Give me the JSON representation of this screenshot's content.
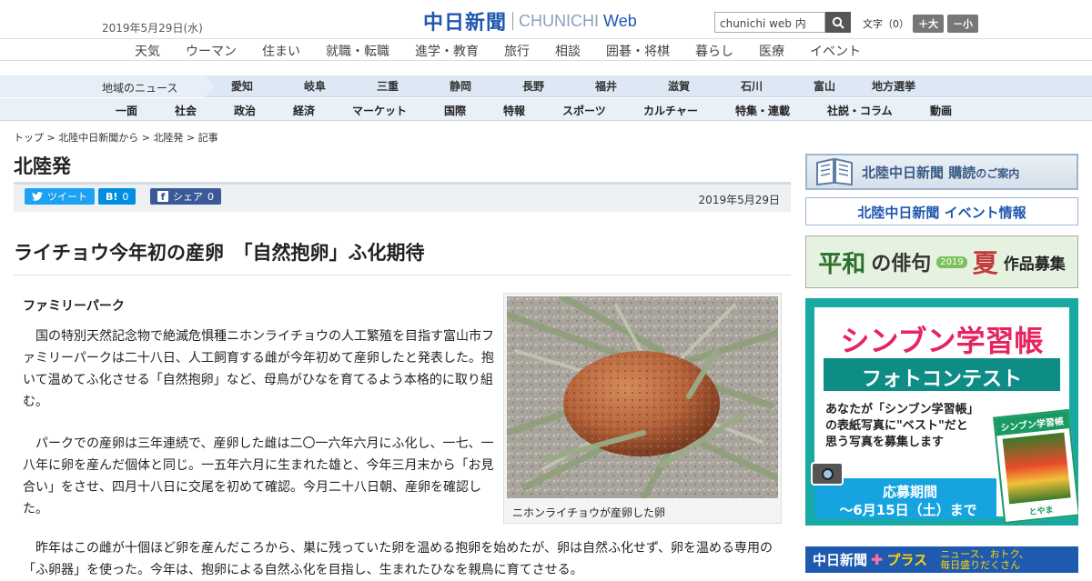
{
  "header": {
    "date": "2019年5月29日(水)",
    "logo_jp": "中日新聞",
    "logo_en": "CHUNICHI",
    "logo_web": "Web",
    "search_placeholder": "chunichi web 内",
    "font_label": "文字（0）",
    "font_larger": "＋大",
    "font_smaller": "－小"
  },
  "nav_categories": [
    "天気",
    "ウーマン",
    "住まい",
    "就職・転職",
    "進学・教育",
    "旅行",
    "相談",
    "囲碁・将棋",
    "暮らし",
    "医療",
    "イベント"
  ],
  "nav_region": {
    "label": "地域のニュース",
    "items": [
      "愛知",
      "岐阜",
      "三重",
      "静岡",
      "長野",
      "福井",
      "滋賀",
      "石川",
      "富山",
      "地方選挙"
    ]
  },
  "nav_sections": [
    "一面",
    "社会",
    "政治",
    "経済",
    "マーケット",
    "国際",
    "特報",
    "スポーツ",
    "カルチャー",
    "特集・連載",
    "社説・コラム",
    "動画"
  ],
  "breadcrumb": [
    "トップ",
    "北陸中日新聞から",
    "北陸発",
    "記事"
  ],
  "section_title": "北陸発",
  "share": {
    "tweet": "ツイート",
    "hatena_label": "B!",
    "hatena_count": "0",
    "facebook": "シェア",
    "facebook_count": "0",
    "publish_date": "2019年5月29日"
  },
  "article": {
    "headline": "ライチョウ今年初の産卵　「自然抱卵」ふ化期待",
    "subhead": "ファミリーパーク",
    "paragraphs": [
      "国の特別天然記念物で絶滅危惧種ニホンライチョウの人工繁殖を目指す富山市ファミリーパークは二十八日、人工飼育する雌が今年初めて産卵したと発表した。抱いて温めてふ化させる「自然抱卵」など、母鳥がひなを育てるよう本格的に取り組む。",
      "パークでの産卵は三年連続で、産卵した雌は二〇一六年六月にふ化し、一七、一八年に卵を産んだ個体と同じ。一五年六月に生まれた雄と、今年三月末から「お見合い」をさせ、四月十八日に交尾を初めて確認。今月二十八日朝、産卵を確認した。"
    ],
    "paragraph_3": "昨年はこの雌が十個ほど卵を産んだころから、巣に残っていた卵を温める抱卵を始めたが、卵は自然ふ化せず、卵を温める専用の「ふ卵器」を使った。今年は、抱卵による自然ふ化を目指し、生まれたひなを親鳥に育てさせる。",
    "photo_caption": "ニホンライチョウが産卵した卵"
  },
  "sidebar": {
    "subscribe": "北陸中日新聞 購読",
    "subscribe_suffix": "のご案内",
    "events": "北陸中日新聞 イベント情報",
    "haiku_1": "平和",
    "haiku_2": "の俳句",
    "haiku_year": "2019",
    "haiku_season": "夏",
    "haiku_recruit": "作品募集",
    "contest_title": "シンブン学習帳",
    "contest_sub": "フォトコンテスト",
    "contest_desc_1": "あなたが「シンブン学習帳」",
    "contest_desc_2": "の表紙写真に\"ベスト\"だと",
    "contest_desc_3": "思う写真を募集します",
    "contest_period_label": "応募期間",
    "contest_period": "〜6月15日（土）まで",
    "notebook_title": "シンブン学習帳",
    "notebook_pref": "とやま",
    "plus_name": "中日新聞",
    "plus_suffix": "プラス",
    "plus_tag_1": "ニュース、おトク、",
    "plus_tag_2": "毎日盛りだくさん"
  },
  "colors": {
    "brand_blue": "#1f57b0",
    "region_nav_bg": "#dde8f4",
    "twitter": "#1da1f2",
    "hatena": "#008fde",
    "facebook": "#3b5998",
    "contest_bg": "#17a9a2"
  }
}
